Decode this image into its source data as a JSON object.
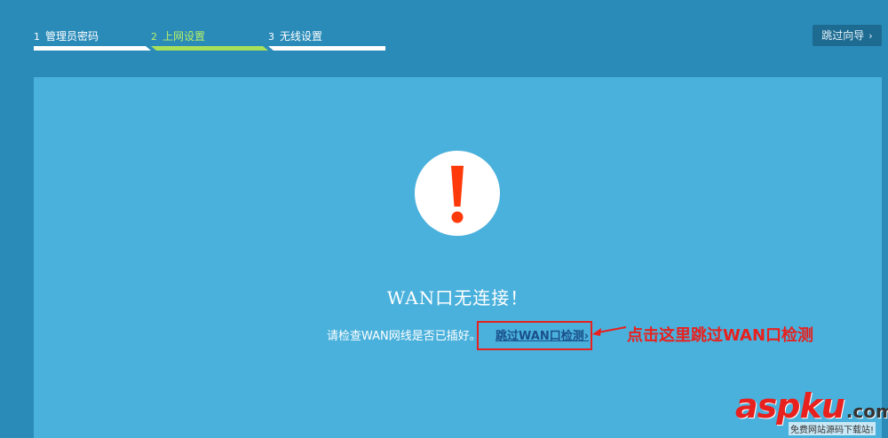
{
  "steps": [
    {
      "number": "1",
      "label": "管理员密码"
    },
    {
      "number": "2",
      "label": "上网设置"
    },
    {
      "number": "3",
      "label": "无线设置"
    }
  ],
  "header": {
    "skip_guide_label": "跳过向导",
    "chevron": "›"
  },
  "main": {
    "icon": "exclamation-icon",
    "title": "WAN口无连接！",
    "hint": "请检查WAN网线是否已插好。",
    "skip_wan_label": "跳过WAN口检测",
    "skip_wan_chevron": "›"
  },
  "annotation": {
    "text": "点击这里跳过WAN口检测",
    "color": "#e8201e"
  },
  "watermark": {
    "logo": "aspku",
    "domain": ".com",
    "subtitle": "免费网站源码下载站!"
  },
  "colors": {
    "background": "#2a8bb9",
    "panel": "#4ab1dc",
    "active_step": "#a9e05a",
    "alert": "#ff3a0a"
  }
}
